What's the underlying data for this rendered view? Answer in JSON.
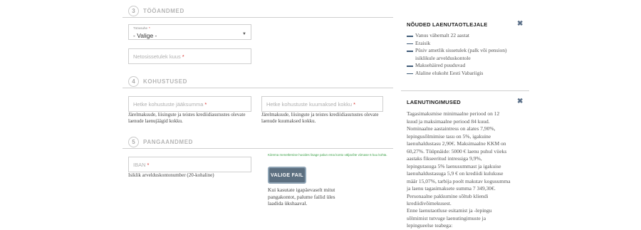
{
  "section3": {
    "num": "3",
    "title": "TÖÖANDMED"
  },
  "employment_select": {
    "label": "Tööosuhe",
    "value": "- Valige -"
  },
  "net_income": {
    "placeholder": "Netosissetulek kuus"
  },
  "section4": {
    "num": "4",
    "title": "KOHUSTUSED"
  },
  "debt_balance": {
    "placeholder": "Hetke kohustuste jääksumma",
    "help": "Järelmaksude, liisingute ja teistes krediidiasutustes olevate laenude laenujäägid kokku."
  },
  "debt_monthly": {
    "placeholder": "Hetke kohustuste kuumaksed kokku",
    "help": "Järelmaksude, liisingute ja teistes krediidiasutustes olevate laenude kuumaksed kokku."
  },
  "section5": {
    "num": "5",
    "title": "PANGAANDMED"
  },
  "iban": {
    "placeholder": "IBAN",
    "help": "Isiklik arvelduskontonumber (20-kohaline)"
  },
  "upload": {
    "note": "Kiirema menetlemise huvides lisage palun ema konto väljavõte viimase 6 kuu kohta.",
    "button": "VALIGE FAIL",
    "help": "Kui kasutate igapäevaselt mitut pangakontot, palume failid üles laadida ükshaaval."
  },
  "requirements": {
    "title": "NÕUDED LAENUTAOTLEJALE",
    "items": [
      "Vanus vähemalt 22 aastat",
      "Eraisik",
      "Püsiv ametlik sissetulek (palk või pension) isiklikule arvelduskontole",
      "Maksehäired puuduvad",
      "Alaline elukoht Eesti Vabariigis"
    ]
  },
  "conditions": {
    "title": "LAENUTINGIMUSED",
    "text": "Tagasimaksmise minimaalne periood on 12 kuud ja maksimaalne periood 84 kuud. Nominaalne aastaintress on alates 7,90%, lepingusõlmimise tasu on 5%, igakuine laenuhaldustasu 2,90€. Maksimaalne KKM on 60,27%. Tüüpnäide: 5000 € laenu puhul viieks aastaks fikseeritud intressiga 9,9%, lepingutasuga 5% laenusummast ja igakuise laenuhaldustasuga 5,9 € on krediidi kulukuse määr 15,07%, tarbija poolt makstav kogusumma ja laenu tagasimaksete summa 7 349,30€. Personaalne pakkumine sõltub kliendi krediidivõimekusest.",
    "text2": "Enne laenutaotluse esitamist ja -lepingu sõlmimist tutvuge laenutingimuste ja lepingueelse teabega:"
  },
  "colors": {
    "required": "#d9312d",
    "accent": "#3f5b78",
    "button": "#5c6f80",
    "note": "#3aa046"
  }
}
